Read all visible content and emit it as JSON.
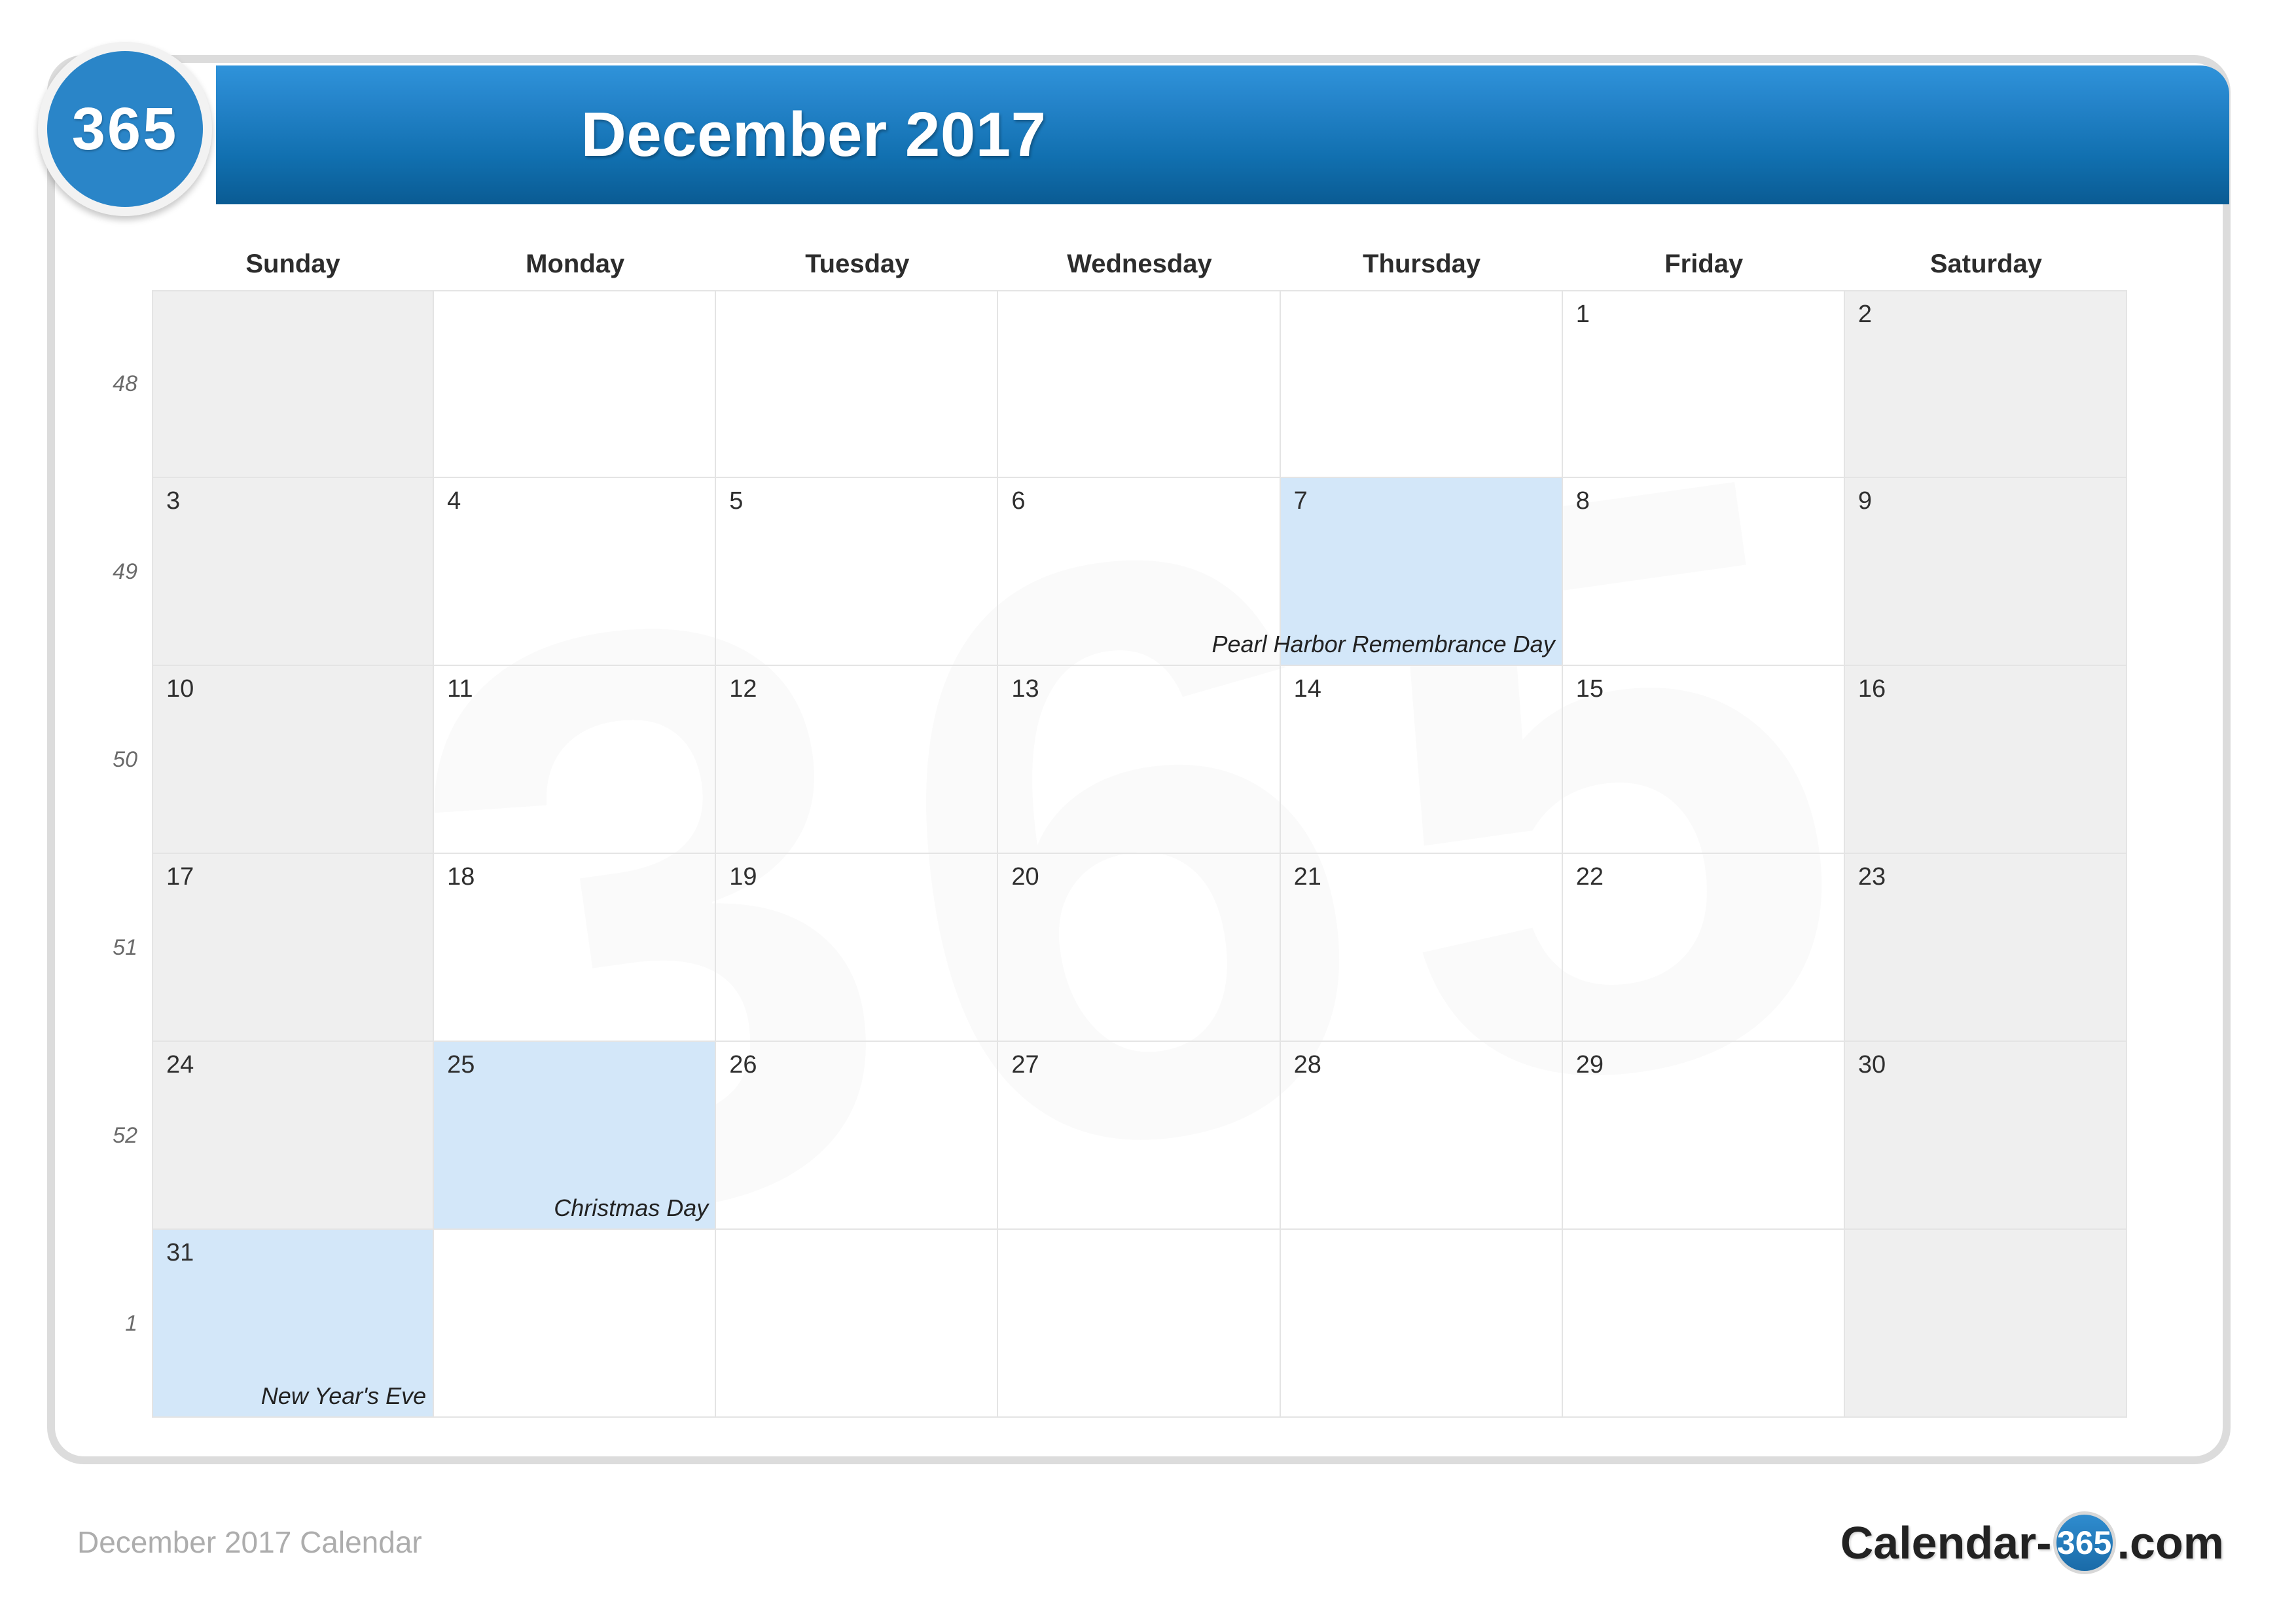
{
  "badge": {
    "label": "365"
  },
  "header": {
    "title": "December 2017"
  },
  "watermark": {
    "text": "365"
  },
  "weekdays": [
    {
      "label": "Sunday"
    },
    {
      "label": "Monday"
    },
    {
      "label": "Tuesday"
    },
    {
      "label": "Wednesday"
    },
    {
      "label": "Thursday"
    },
    {
      "label": "Friday"
    },
    {
      "label": "Saturday"
    }
  ],
  "week_numbers": [
    "48",
    "49",
    "50",
    "51",
    "52",
    "1"
  ],
  "weeks": [
    {
      "days": [
        {
          "num": "",
          "holiday": "",
          "weekend": true,
          "highlight": false
        },
        {
          "num": "",
          "holiday": "",
          "weekend": false,
          "highlight": false
        },
        {
          "num": "",
          "holiday": "",
          "weekend": false,
          "highlight": false
        },
        {
          "num": "",
          "holiday": "",
          "weekend": false,
          "highlight": false
        },
        {
          "num": "",
          "holiday": "",
          "weekend": false,
          "highlight": false
        },
        {
          "num": "1",
          "holiday": "",
          "weekend": false,
          "highlight": false
        },
        {
          "num": "2",
          "holiday": "",
          "weekend": true,
          "highlight": false
        }
      ]
    },
    {
      "days": [
        {
          "num": "3",
          "holiday": "",
          "weekend": true,
          "highlight": false
        },
        {
          "num": "4",
          "holiday": "",
          "weekend": false,
          "highlight": false
        },
        {
          "num": "5",
          "holiday": "",
          "weekend": false,
          "highlight": false
        },
        {
          "num": "6",
          "holiday": "",
          "weekend": false,
          "highlight": false
        },
        {
          "num": "7",
          "holiday": "Pearl Harbor Remembrance Day",
          "weekend": false,
          "highlight": true
        },
        {
          "num": "8",
          "holiday": "",
          "weekend": false,
          "highlight": false
        },
        {
          "num": "9",
          "holiday": "",
          "weekend": true,
          "highlight": false
        }
      ]
    },
    {
      "days": [
        {
          "num": "10",
          "holiday": "",
          "weekend": true,
          "highlight": false
        },
        {
          "num": "11",
          "holiday": "",
          "weekend": false,
          "highlight": false
        },
        {
          "num": "12",
          "holiday": "",
          "weekend": false,
          "highlight": false
        },
        {
          "num": "13",
          "holiday": "",
          "weekend": false,
          "highlight": false
        },
        {
          "num": "14",
          "holiday": "",
          "weekend": false,
          "highlight": false
        },
        {
          "num": "15",
          "holiday": "",
          "weekend": false,
          "highlight": false
        },
        {
          "num": "16",
          "holiday": "",
          "weekend": true,
          "highlight": false
        }
      ]
    },
    {
      "days": [
        {
          "num": "17",
          "holiday": "",
          "weekend": true,
          "highlight": false
        },
        {
          "num": "18",
          "holiday": "",
          "weekend": false,
          "highlight": false
        },
        {
          "num": "19",
          "holiday": "",
          "weekend": false,
          "highlight": false
        },
        {
          "num": "20",
          "holiday": "",
          "weekend": false,
          "highlight": false
        },
        {
          "num": "21",
          "holiday": "",
          "weekend": false,
          "highlight": false
        },
        {
          "num": "22",
          "holiday": "",
          "weekend": false,
          "highlight": false
        },
        {
          "num": "23",
          "holiday": "",
          "weekend": true,
          "highlight": false
        }
      ]
    },
    {
      "days": [
        {
          "num": "24",
          "holiday": "",
          "weekend": true,
          "highlight": false
        },
        {
          "num": "25",
          "holiday": "Christmas Day",
          "weekend": false,
          "highlight": true
        },
        {
          "num": "26",
          "holiday": "",
          "weekend": false,
          "highlight": false
        },
        {
          "num": "27",
          "holiday": "",
          "weekend": false,
          "highlight": false
        },
        {
          "num": "28",
          "holiday": "",
          "weekend": false,
          "highlight": false
        },
        {
          "num": "29",
          "holiday": "",
          "weekend": false,
          "highlight": false
        },
        {
          "num": "30",
          "holiday": "",
          "weekend": true,
          "highlight": false
        }
      ]
    },
    {
      "days": [
        {
          "num": "31",
          "holiday": "New Year's Eve",
          "weekend": true,
          "highlight": true
        },
        {
          "num": "",
          "holiday": "",
          "weekend": false,
          "highlight": false
        },
        {
          "num": "",
          "holiday": "",
          "weekend": false,
          "highlight": false
        },
        {
          "num": "",
          "holiday": "",
          "weekend": false,
          "highlight": false
        },
        {
          "num": "",
          "holiday": "",
          "weekend": false,
          "highlight": false
        },
        {
          "num": "",
          "holiday": "",
          "weekend": false,
          "highlight": false
        },
        {
          "num": "",
          "holiday": "",
          "weekend": true,
          "highlight": false
        }
      ]
    }
  ],
  "footer": {
    "caption": "December 2017 Calendar",
    "logo_prefix": "Calendar-",
    "logo_badge": "365",
    "logo_suffix": ".com"
  },
  "colors": {
    "header_blue_top": "#2f93da",
    "header_blue_bottom": "#0a5b93",
    "weekend_gray": "#efefef",
    "holiday_blue": "#d3e7f9",
    "gridline": "#e4e4e4",
    "card_border": "#dcdcdc"
  }
}
